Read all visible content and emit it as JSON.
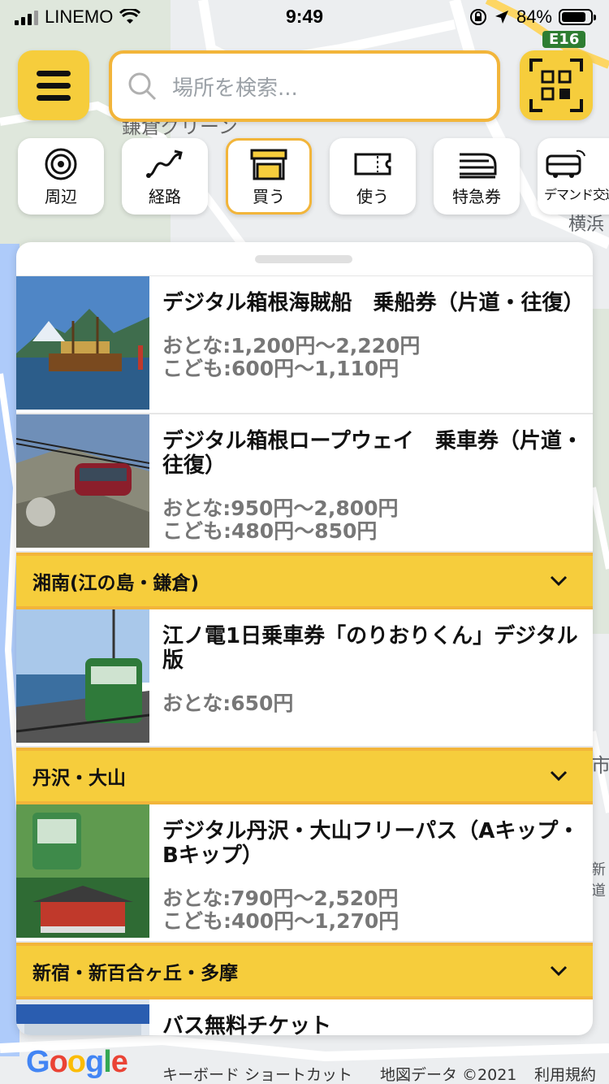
{
  "status_bar": {
    "carrier": "LINEMO",
    "time": "9:49",
    "battery": "84%",
    "battery_level": 0.84
  },
  "search": {
    "placeholder": "場所を検索..."
  },
  "map_labels": {
    "road_sign": "E16",
    "poi": "鎌倉グリーン",
    "place_right": "横浜",
    "place_right_2": "市",
    "place_right_3": "新道"
  },
  "chips": [
    {
      "label": "周辺",
      "icon": "nearby-icon"
    },
    {
      "label": "経路",
      "icon": "route-icon"
    },
    {
      "label": "買う",
      "icon": "shop-icon",
      "active": true
    },
    {
      "label": "使う",
      "icon": "ticket-icon"
    },
    {
      "label": "特急券",
      "icon": "express-ticket-icon"
    },
    {
      "label": "デマンド交通",
      "icon": "demand-bus-icon"
    }
  ],
  "items": [
    {
      "title": "デジタル箱根海賊船　乗船券（片道・往復）",
      "price_adult": "おとな:1,200円〜2,220円",
      "price_child": "こども:600円〜1,110円"
    },
    {
      "title": "デジタル箱根ロープウェイ　乗車券（片道・往復）",
      "price_adult": "おとな:950円〜2,800円",
      "price_child": "こども:480円〜850円"
    },
    {
      "title": "江ノ電1日乗車券「のりおりくん」デジタル版",
      "price_adult": "おとな:650円"
    },
    {
      "title": "デジタル丹沢・大山フリーパス（Aキップ・Bキップ）",
      "price_adult": "おとな:790円〜2,520円",
      "price_child": "こども:400円〜1,270円"
    },
    {
      "title": "バス無料チケット"
    }
  ],
  "sections": [
    {
      "label": "湘南(江の島・鎌倉)"
    },
    {
      "label": "丹沢・大山"
    },
    {
      "label": "新宿・新百合ヶ丘・多摩"
    }
  ],
  "footer": {
    "logo": "Google",
    "keyboard_shortcuts": "キーボード ショートカット",
    "map_data": "地図データ ©2021",
    "terms": "利用規約"
  },
  "colors": {
    "accent": "#f6cd3c",
    "accent_border": "#f2b53a",
    "price_text": "#777777"
  }
}
